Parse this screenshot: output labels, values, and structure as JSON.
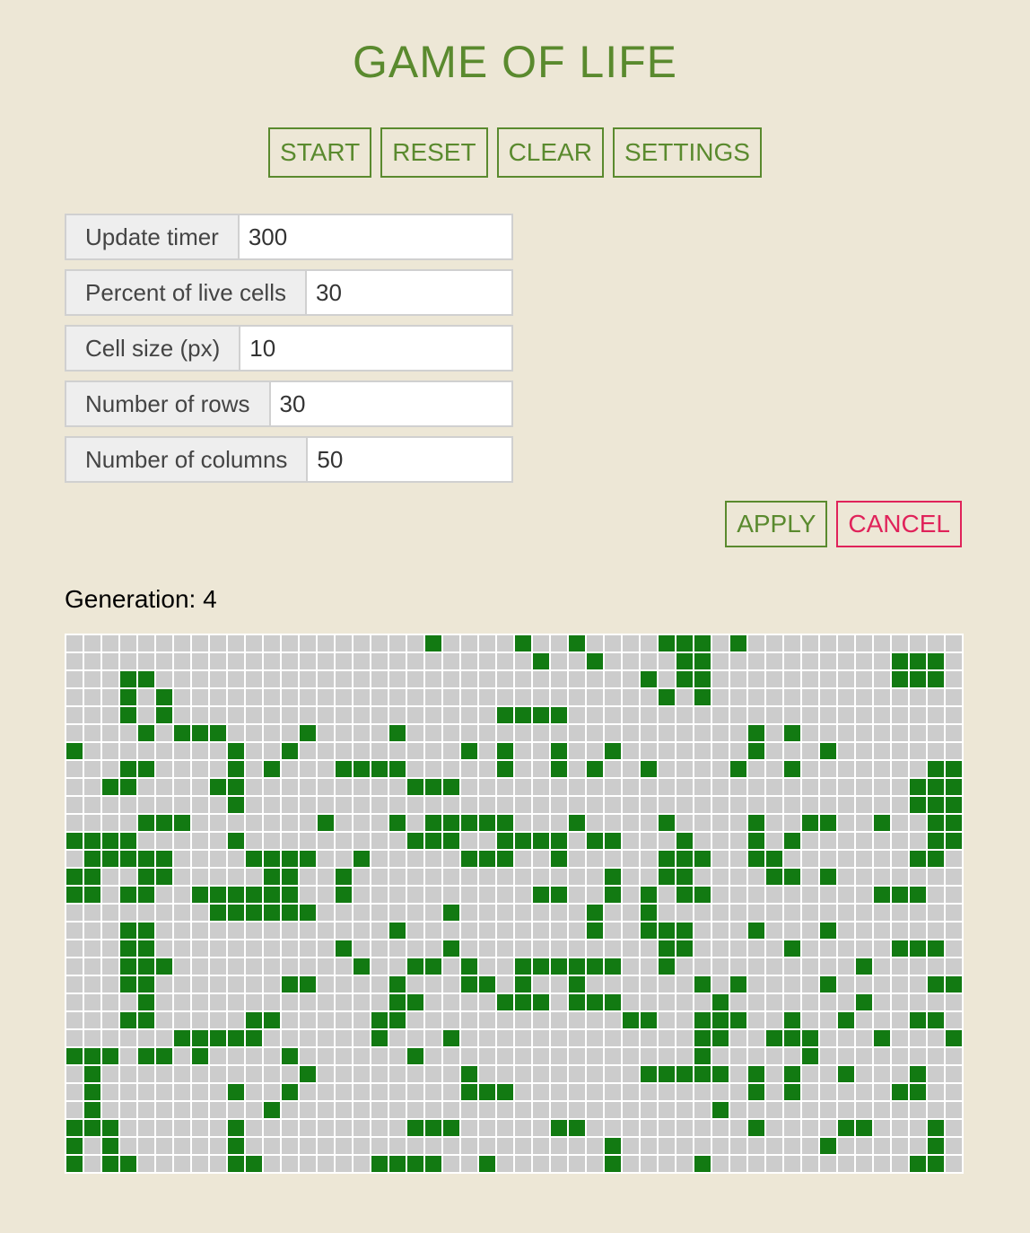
{
  "title": "GAME OF LIFE",
  "toolbar": {
    "start_label": "START",
    "reset_label": "RESET",
    "clear_label": "CLEAR",
    "settings_label": "SETTINGS"
  },
  "settings": [
    {
      "label": "Update timer",
      "value": "300"
    },
    {
      "label": "Percent of live cells",
      "value": "30"
    },
    {
      "label": "Cell size (px)",
      "value": "10"
    },
    {
      "label": "Number of rows",
      "value": "30"
    },
    {
      "label": "Number of columns",
      "value": "50"
    }
  ],
  "actions": {
    "apply_label": "APPLY",
    "cancel_label": "CANCEL"
  },
  "generation_label": "Generation: 4",
  "colors": {
    "accent": "#5a8a2e",
    "danger": "#e0235a",
    "live_cell": "#127a12",
    "dead_cell": "#cccccc",
    "background": "#ede7d6"
  },
  "board": {
    "rows": 30,
    "cols": 50,
    "cells": [
      "....................#....#..#....###.#............",
      "..........................#..#....##..........###.",
      "...##...........................#.##..........###.",
      "...#.#...........................#.#..............",
      "...#.#..................####......................#",
      "....#.###....#....#...................#.#.........",
      "#........#..#.........#.#..#..#.......#...#.......",
      "...##....#.#...####.....#..#.#..#....#..#.......##",
      "..##....##.........###.........................###",
      ".........#.....................................###.",
      "....###.......#...#.#####...#....#....#..##..#..##",
      "####.....#.........###..####.##...#...#.#.......##",
      ".#####....####..#.....###..#.....###..##.......##.",
      "##..##.....##..#..............#..##....##.#.......",
      "##.##..######..#..........##..#.#.##.........###..",
      "........######.......#.......#..#..................",
      "...##.............#..........#..###...#...#.......",
      "...##..........#.....#...........##.....#.....###.",
      "...###..........#..##.#..######..#..........#.....",
      "...##.......##....#...##.#..#......#.#....#.....###",
      "....#.............##....###.###.....#.......#.....",
      "...##.....##.....##............##..###..#..#...##.",
      "......#####......#...#.............##..###...#...##",
      "###.##.#....#......#...............#.....#........",
      ".#...........#........#.........#####.#.#..#...#..",
      ".#.......#..#.........###.............#.#.....##...",
      ".#.........#........................#.............",
      "###......#.........###.....##.........#....##...#.",
      "#.#......#....................#...........#.....#.",
      "#.##.....##......####..#......#....#...........##."
    ]
  }
}
